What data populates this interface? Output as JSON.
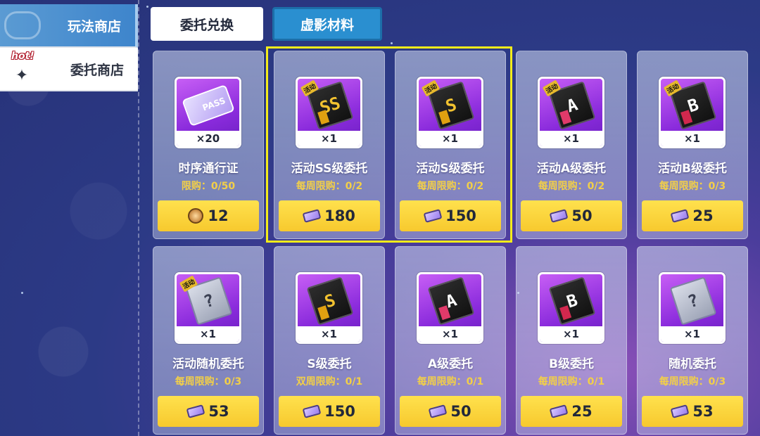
{
  "sidebar": {
    "items": [
      {
        "label": "玩法商店",
        "active": true
      },
      {
        "label": "委托商店",
        "active": false,
        "tag": "hot!"
      }
    ]
  },
  "tabs": [
    {
      "label": "委托兑换",
      "active": false
    },
    {
      "label": "虚影材料",
      "active": true
    }
  ],
  "event_mark": "活动",
  "pass_text": "PASS",
  "items": [
    {
      "name": "时序通行证",
      "qty": "×20",
      "limit": "限购：0/50",
      "price": "12",
      "currency": "medal-icon",
      "art": "pass"
    },
    {
      "name": "活动SS级委托",
      "qty": "×1",
      "limit": "每周限购：0/2",
      "price": "180",
      "currency": "ticket-icon",
      "art": "SS"
    },
    {
      "name": "活动S级委托",
      "qty": "×1",
      "limit": "每周限购：0/2",
      "price": "150",
      "currency": "ticket-icon",
      "art": "S"
    },
    {
      "name": "活动A级委托",
      "qty": "×1",
      "limit": "每周限购：0/2",
      "price": "50",
      "currency": "ticket-icon",
      "art": "A"
    },
    {
      "name": "活动B级委托",
      "qty": "×1",
      "limit": "每周限购：0/3",
      "price": "25",
      "currency": "ticket-icon",
      "art": "B"
    },
    {
      "name": "活动随机委托",
      "qty": "×1",
      "limit": "每周限购：0/3",
      "price": "53",
      "currency": "ticket-icon",
      "art": "?"
    },
    {
      "name": "S级委托",
      "qty": "×1",
      "limit": "双周限购：0/1",
      "price": "150",
      "currency": "ticket-icon",
      "art": "S"
    },
    {
      "name": "A级委托",
      "qty": "×1",
      "limit": "每周限购：0/1",
      "price": "50",
      "currency": "ticket-icon",
      "art": "A"
    },
    {
      "name": "B级委托",
      "qty": "×1",
      "limit": "每周限购：0/1",
      "price": "25",
      "currency": "ticket-icon",
      "art": "B"
    },
    {
      "name": "随机委托",
      "qty": "×1",
      "limit": "每周限购：0/3",
      "price": "53",
      "currency": "ticket-icon",
      "art": "?"
    }
  ],
  "colors": {
    "accent_tab": "#2a8fd0",
    "price_button": "#f7c92e",
    "limit_text": "#f2cf48",
    "selection_border": "#f4ec1a"
  }
}
